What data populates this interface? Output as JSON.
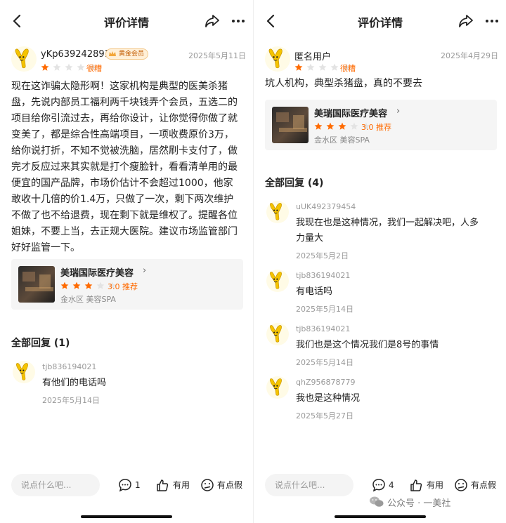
{
  "page_title": "评价详情",
  "left": {
    "review": {
      "username": "yKp639242891",
      "badge": "黄金会员",
      "date": "2025年5月11日",
      "rating_stars": 1,
      "rating_label": "很糟",
      "lines": [
        "现在这诈骗太隐形啊！这家机构是典型的医美杀猪",
        "盘，先说内部员工福利两千块钱弄个会员，五选二的",
        "项目给你引流过去，再给你设计，让你觉得你做了就",
        "变美了，都是综合性高端项目，一项收费原价3万，",
        "给你说打折，不知不觉被洗脑，居然刷卡支付了，做",
        "完才反应过来其实就是打个瘦脸针，看看清单用的最",
        "便宜的国产品牌，市场价估计不会超过1000，他家",
        "敢收十几倍的价1.4万，只做了一次，剩下两次维护",
        "不做了也不给退费，现在剩下就是维权了。提醒各位",
        "姐妹，不要上当，去正规大医院。建议市场监管部门",
        "好好监管一下。"
      ]
    },
    "shop": {
      "name": "美瑞国际医疗美容",
      "stars": 3,
      "score": "3.0 推荐",
      "location": "金水区 美容SPA"
    },
    "replies_title": "全部回复 (1)",
    "replies": [
      {
        "name": "tjb836194021",
        "text": "有他们的电话吗",
        "date": "2025年5月14日"
      }
    ],
    "input_placeholder": "说点什么吧...",
    "comment_count": "1",
    "useful_label": "有用",
    "fake_label": "有点假"
  },
  "right": {
    "review": {
      "username": "匿名用户",
      "date": "2025年4月29日",
      "rating_stars": 1,
      "rating_label": "很糟",
      "text": "坑人机构，典型杀猪盘，真的不要去"
    },
    "shop": {
      "name": "美瑞国际医疗美容",
      "stars": 3,
      "score": "3.0 推荐",
      "location": "金水区 美容SPA"
    },
    "replies_title": "全部回复 (4)",
    "replies": [
      {
        "name": "uUK492379454",
        "lines": [
          "我现在也是这种情况，我们一起解决吧，人多",
          "力量大"
        ],
        "date": "2025年5月2日"
      },
      {
        "name": "tjb836194021",
        "lines": [
          "有电话吗"
        ],
        "date": "2025年5月14日"
      },
      {
        "name": "tjb836194021",
        "lines": [
          "我们也是这个情况我们是8号的事情"
        ],
        "date": "2025年5月14日"
      },
      {
        "name": "qhZ956878779",
        "lines": [
          "我也是这种情况"
        ],
        "date": "2025年5月27日"
      }
    ],
    "input_placeholder": "说点什么吧...",
    "comment_count": "4",
    "useful_label": "有用",
    "fake_label": "有点假"
  },
  "watermark": "公众号 · 一美社",
  "colors": {
    "accent": "#ff6a00",
    "star_off": "#e3e3e3",
    "text": "#222222",
    "muted": "#999999"
  },
  "icons": [
    "back-arrow-icon",
    "share-icon",
    "more-icon",
    "comment-icon",
    "thumbs-up-icon",
    "meh-face-icon",
    "star-icon",
    "wechat-icon"
  ]
}
